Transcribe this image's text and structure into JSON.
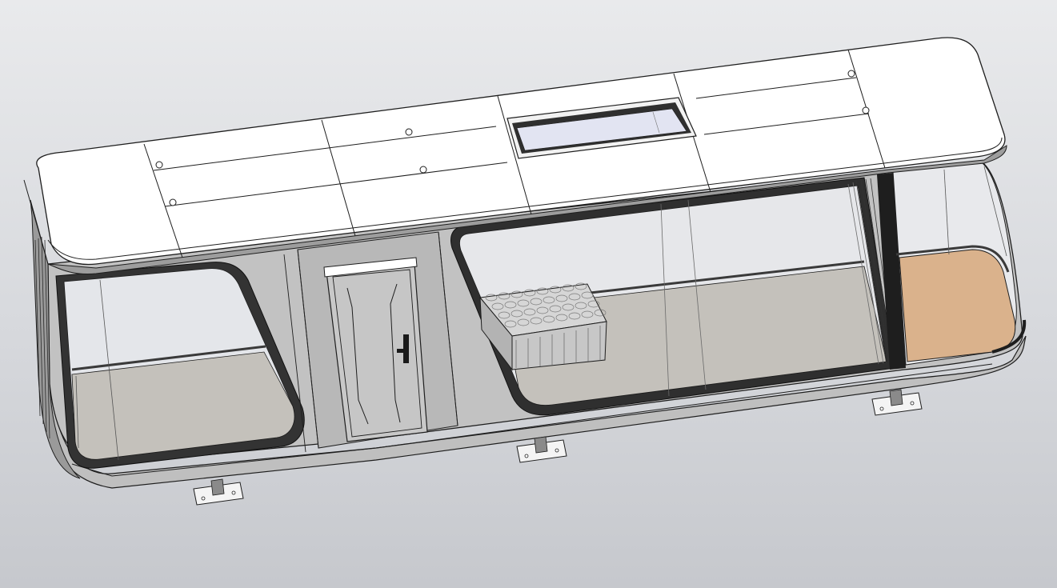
{
  "viewport": {
    "background_top": "#e9eaec",
    "background_bottom": "#c6c8cd"
  },
  "model": {
    "roof_color": "#ffffff",
    "wall_color": "#c2c2c2",
    "glass_color": "#e4e6ea",
    "floor_color": "#c4c1bb",
    "bathroom_floor_color": "#dab28c",
    "trim_color": "#3a3a3a",
    "edge_color": "#1e1e1e"
  },
  "icons": [
    "door-handle-icon",
    "skylight-icon",
    "mount-bracket-icon"
  ]
}
